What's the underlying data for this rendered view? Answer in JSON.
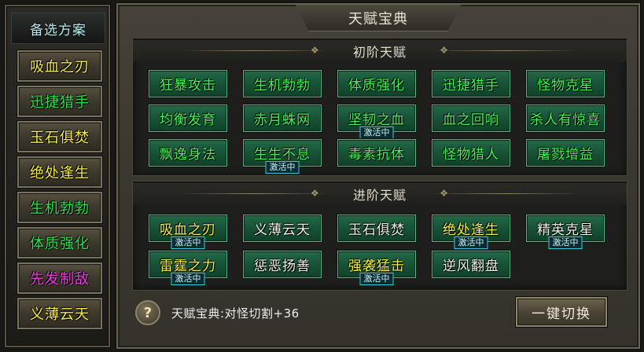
{
  "sidebar": {
    "title": "备选方案",
    "items": [
      {
        "label": "吸血之刃",
        "color": "#f4ea4c"
      },
      {
        "label": "迅捷猎手",
        "color": "#2ee04a"
      },
      {
        "label": "玉石俱焚",
        "color": "#f4ea4c"
      },
      {
        "label": "绝处逢生",
        "color": "#f4ea4c"
      },
      {
        "label": "生机勃勃",
        "color": "#2ee04a"
      },
      {
        "label": "体质强化",
        "color": "#2ee04a"
      },
      {
        "label": "先发制敌",
        "color": "#ee3ce2"
      },
      {
        "label": "义薄云天",
        "color": "#f4ea4c"
      }
    ]
  },
  "main": {
    "title": "天赋宝典",
    "basic": {
      "header": "初阶天赋",
      "talents": [
        {
          "label": "狂暴攻击"
        },
        {
          "label": "生机勃勃"
        },
        {
          "label": "体质强化"
        },
        {
          "label": "迅捷猎手"
        },
        {
          "label": "怪物克星"
        },
        {
          "label": "均衡发育"
        },
        {
          "label": "赤月蛛网"
        },
        {
          "label": "坚韧之血",
          "badge": "激活中"
        },
        {
          "label": "血之回响"
        },
        {
          "label": "杀人有惊喜"
        },
        {
          "label": "飘逸身法"
        },
        {
          "label": "生生不息",
          "badge": "激活中"
        },
        {
          "label": "毒素抗体"
        },
        {
          "label": "怪物猎人"
        },
        {
          "label": "屠戮增益"
        }
      ]
    },
    "advanced": {
      "header": "进阶天赋",
      "talents": [
        {
          "label": "吸血之刃",
          "badge": "激活中"
        },
        {
          "label": "义薄云天"
        },
        {
          "label": "玉石俱焚"
        },
        {
          "label": "绝处逢生",
          "badge": "激活中"
        },
        {
          "label": "精英克星",
          "badge": "激活中"
        },
        {
          "label": "雷霆之力",
          "badge": "激活中"
        },
        {
          "label": "惩恶扬善"
        },
        {
          "label": "强袭猛击",
          "badge": "激活中"
        },
        {
          "label": "逆风翻盘"
        }
      ]
    }
  },
  "footer": {
    "help_icon": "question-mark",
    "info": "天赋宝典:对怪切割+36",
    "switch_label": "一键切换"
  }
}
